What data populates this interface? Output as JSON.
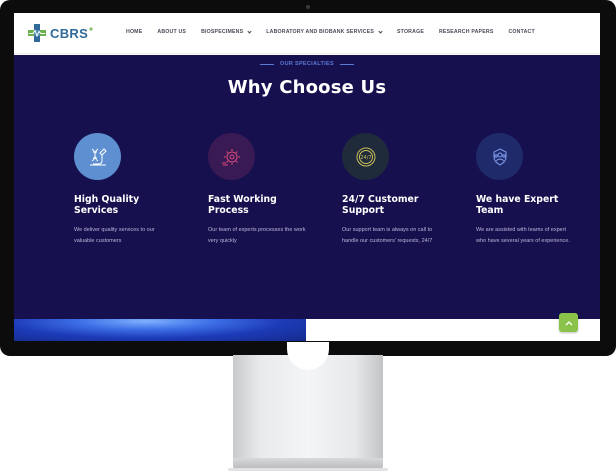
{
  "brand": {
    "name": "CBRS"
  },
  "nav": {
    "items": [
      {
        "label": "HOME",
        "dropdown": false
      },
      {
        "label": "ABOUT US",
        "dropdown": false
      },
      {
        "label": "BIOSPECIMENS",
        "dropdown": true
      },
      {
        "label": "LABORATORY AND BIOBANK SERVICES",
        "dropdown": true
      },
      {
        "label": "STORAGE",
        "dropdown": false
      },
      {
        "label": "RESEARCH PAPERS",
        "dropdown": false
      },
      {
        "label": "CONTACT",
        "dropdown": false
      }
    ]
  },
  "specialties": {
    "eyebrow": "OUR SPECIALTIES",
    "title": "Why Choose Us",
    "features": [
      {
        "icon": "dna-microscope-icon",
        "title": "High Quality Services",
        "description": "We deliver quality services to our valuable customers",
        "icon_bg": "#5e8fd0"
      },
      {
        "icon": "fast-process-icon",
        "title": "Fast Working Process",
        "description": "Our team of experts processes the work very quickly",
        "icon_bg": "#3a1a55"
      },
      {
        "icon": "clock-24-7-icon",
        "title": "24/7 Customer Support",
        "description": "Our support team is always on call to handle our customers' requests, 24/7",
        "icon_bg": "#1f2a3a"
      },
      {
        "icon": "expert-team-icon",
        "title": "We have Expert Team",
        "description": "We are assisted with teams of expert who have several years of experience.",
        "icon_bg": "#1f2a6a"
      }
    ]
  },
  "colors": {
    "section_bg": "#17104f",
    "accent_blue": "#5d7bd6",
    "brand_blue": "#2f6a9a",
    "brand_green": "#6ab04c",
    "scroll_top_green": "#8bc34a"
  },
  "scroll_top": {
    "icon": "chevron-up-icon"
  }
}
